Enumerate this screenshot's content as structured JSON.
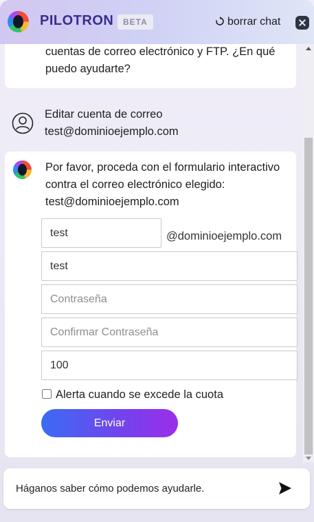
{
  "header": {
    "title": "PILOTRON",
    "badge": "BETA",
    "clear_label": "borrar chat"
  },
  "messages": [
    {
      "role": "bot",
      "text": "cuentas de correo electrónico y FTP. ¿En qué puedo ayudarte?"
    },
    {
      "role": "user",
      "lines": [
        "Editar cuenta de correo",
        "test@dominioejemplo.com"
      ]
    },
    {
      "role": "bot",
      "text": "Por favor, proceda con el formulario interactivo contra el correo electrónico elegido: test@dominioejemplo.com"
    }
  ],
  "form": {
    "username_value": "test",
    "domain_suffix": "@dominioejemplo.com",
    "name_value": "test",
    "password_placeholder": "Contraseña",
    "confirm_placeholder": "Confirmar Contraseña",
    "quota_value": "100",
    "alert_label": "Alerta cuando se excede la cuota",
    "alert_checked": false,
    "submit_label": "Enviar"
  },
  "composer": {
    "placeholder": "Háganos saber cómo podemos ayudarle."
  },
  "icons": {
    "logo": "pilotron-logo-icon",
    "refresh": "refresh-icon",
    "close": "close-icon",
    "user": "user-icon",
    "send": "send-icon"
  },
  "colors": {
    "brand": "#3a2d8e",
    "button_gradient_start": "#3b6cf3",
    "button_gradient_end": "#9a2fe9"
  }
}
